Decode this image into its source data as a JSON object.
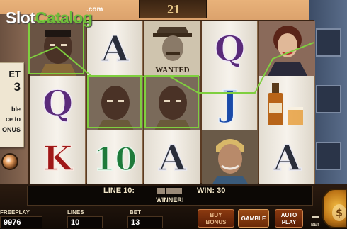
{
  "logo": {
    "slot": "Slot",
    "catalog": "Catalog",
    "dotcom": ".com"
  },
  "lines_sign": "21",
  "poster": {
    "line1": "ET",
    "line2": "3",
    "line3": "ble",
    "line4": "ce to",
    "line5": "ONUS"
  },
  "reels": [
    [
      "bandit",
      "Q",
      "K"
    ],
    [
      "A",
      "bandit",
      "10"
    ],
    [
      "wanted",
      "bandit",
      "A"
    ],
    [
      "Q",
      "J",
      "bandit-blond"
    ],
    [
      "lady",
      "whiskey",
      "A"
    ]
  ],
  "symbol_colors": {
    "A": "#2a2e3a",
    "Q": "#5a2a7a",
    "K": "#a01818",
    "10": "#1e7a3a",
    "J": "#1a4aa8"
  },
  "highlight_color": "#7fcf3f",
  "message": {
    "line_label": "LINE 10:",
    "win_label": "WIN: 30",
    "winner": "WINNER!"
  },
  "stats": {
    "freeplay_label": "FREEPLAY",
    "freeplay_value": "9976",
    "lines_label": "LINES",
    "lines_value": "10",
    "bet_label": "BET",
    "bet_value": "13"
  },
  "buttons": {
    "buy_line1": "BUY",
    "buy_line2": "BONUS",
    "gamble": "GAMBLE",
    "auto_line1": "AUTO",
    "auto_line2": "PLAY",
    "bet_small": "BET"
  },
  "wanted_text": "WANTED"
}
